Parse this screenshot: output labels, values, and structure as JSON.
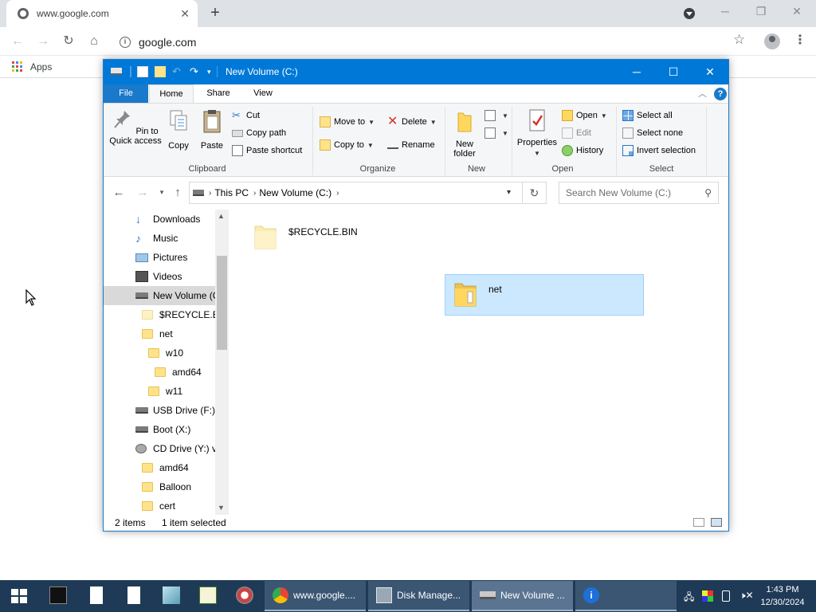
{
  "browser": {
    "tab_title": "www.google.com",
    "url": "google.com",
    "bookmarks_apps": "Apps"
  },
  "explorer": {
    "window_title": "New Volume (C:)",
    "tabs": {
      "file": "File",
      "home": "Home",
      "share": "Share",
      "view": "View"
    },
    "ribbon": {
      "clipboard": {
        "label": "Clipboard",
        "pin": "Pin to Quick access",
        "copy": "Copy",
        "paste": "Paste",
        "cut": "Cut",
        "copy_path": "Copy path",
        "paste_shortcut": "Paste shortcut"
      },
      "organize": {
        "label": "Organize",
        "move_to": "Move to",
        "copy_to": "Copy to",
        "delete": "Delete",
        "rename": "Rename"
      },
      "new": {
        "label": "New",
        "new_folder": "New folder"
      },
      "open": {
        "label": "Open",
        "properties": "Properties",
        "open": "Open",
        "edit": "Edit",
        "history": "History"
      },
      "select": {
        "label": "Select",
        "select_all": "Select all",
        "select_none": "Select none",
        "invert": "Invert selection"
      }
    },
    "address": {
      "crumb1": "This PC",
      "crumb2": "New Volume (C:)",
      "search_placeholder": "Search New Volume (C:)"
    },
    "nav": [
      {
        "label": "Downloads"
      },
      {
        "label": "Music"
      },
      {
        "label": "Pictures"
      },
      {
        "label": "Videos"
      },
      {
        "label": "New Volume (C"
      },
      {
        "label": "$RECYCLE.BIN"
      },
      {
        "label": "net"
      },
      {
        "label": "w10"
      },
      {
        "label": "amd64"
      },
      {
        "label": "w11"
      },
      {
        "label": "USB Drive (F:)"
      },
      {
        "label": "Boot (X:)"
      },
      {
        "label": "CD Drive (Y:) vi"
      },
      {
        "label": "amd64"
      },
      {
        "label": "Balloon"
      },
      {
        "label": "cert"
      }
    ],
    "items": [
      {
        "name": "$RECYCLE.BIN"
      },
      {
        "name": "net"
      }
    ],
    "status": {
      "count": "2 items",
      "selected": "1 item selected"
    }
  },
  "taskbar": {
    "buttons": [
      {
        "label": "www.google...."
      },
      {
        "label": "Disk Manage..."
      },
      {
        "label": "New Volume ..."
      }
    ],
    "time": "1:43 PM",
    "date": "12/30/2024"
  },
  "colors": {
    "explorer_title": "#0078d7",
    "file_tab": "#1979ca",
    "selection": "#cce8ff",
    "taskbar": "#1f3a56"
  }
}
